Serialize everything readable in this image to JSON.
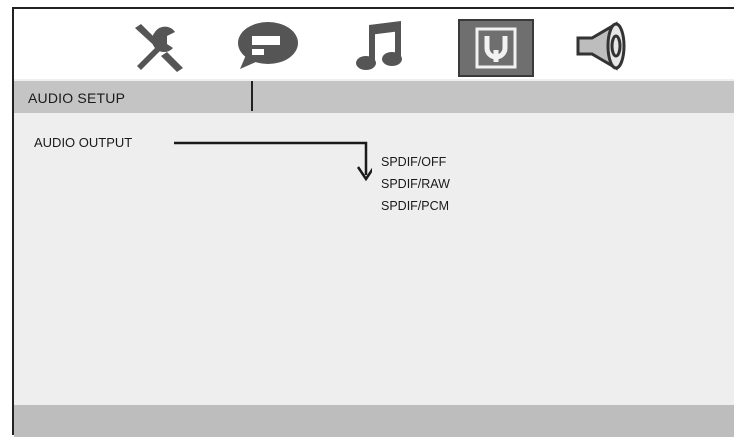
{
  "tabs": [
    {
      "icon": "wrench-tools-icon"
    },
    {
      "icon": "speech-bubble-icon"
    },
    {
      "icon": "music-note-icon"
    },
    {
      "icon": "audio-connector-icon",
      "selected": true
    },
    {
      "icon": "speaker-icon"
    }
  ],
  "header": {
    "title": "AUDIO SETUP"
  },
  "audio_output": {
    "label": "AUDIO OUTPUT",
    "options": [
      "SPDIF/OFF",
      "SPDIF/RAW",
      "SPDIF/PCM"
    ]
  },
  "colors": {
    "selected_tab_bg": "#6f6f6f",
    "header_bg": "#c4c4c4",
    "panel_bg": "#eeeeee",
    "footer_bg": "#bdbdbd",
    "icon": "#555555"
  }
}
